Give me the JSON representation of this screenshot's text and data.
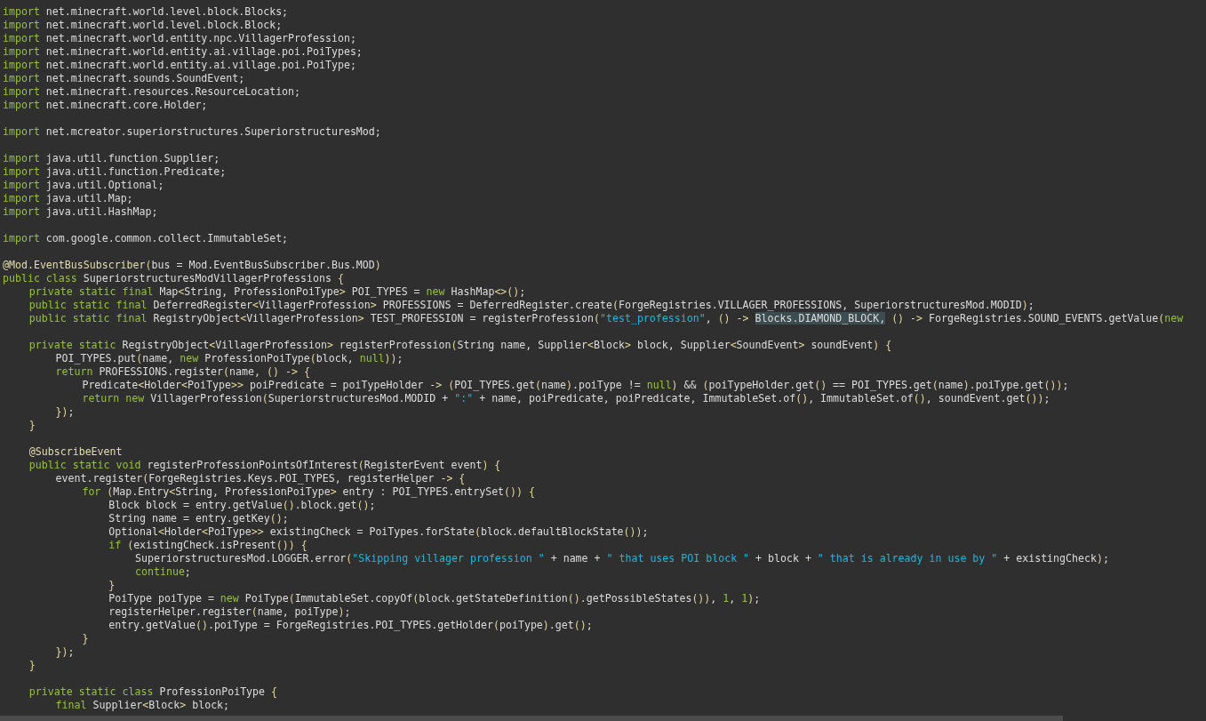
{
  "editor": {
    "lines": [
      {
        "kind": "code",
        "tokens": [
          {
            "kind": "keyword",
            "text": "import"
          },
          {
            "kind": "plain",
            "text": " net.minecraft.world.level.block.Blocks;"
          }
        ]
      },
      {
        "kind": "code",
        "tokens": [
          {
            "kind": "keyword",
            "text": "import"
          },
          {
            "kind": "plain",
            "text": " net.minecraft.world.level.block.Block;"
          }
        ]
      },
      {
        "kind": "code",
        "tokens": [
          {
            "kind": "keyword",
            "text": "import"
          },
          {
            "kind": "plain",
            "text": " net.minecraft.world.entity.npc.VillagerProfession;"
          }
        ]
      },
      {
        "kind": "code",
        "tokens": [
          {
            "kind": "keyword",
            "text": "import"
          },
          {
            "kind": "plain",
            "text": " net.minecraft.world.entity.ai.village.poi.PoiTypes;"
          }
        ]
      },
      {
        "kind": "code",
        "tokens": [
          {
            "kind": "keyword",
            "text": "import"
          },
          {
            "kind": "plain",
            "text": " net.minecraft.world.entity.ai.village.poi.PoiType;"
          }
        ]
      },
      {
        "kind": "code",
        "tokens": [
          {
            "kind": "keyword",
            "text": "import"
          },
          {
            "kind": "plain",
            "text": " net.minecraft.sounds.SoundEvent;"
          }
        ]
      },
      {
        "kind": "code",
        "tokens": [
          {
            "kind": "keyword",
            "text": "import"
          },
          {
            "kind": "plain",
            "text": " net.minecraft.resources.ResourceLocation;"
          }
        ]
      },
      {
        "kind": "code",
        "tokens": [
          {
            "kind": "keyword",
            "text": "import"
          },
          {
            "kind": "plain",
            "text": " net.minecraft.core.Holder;"
          }
        ]
      },
      {
        "kind": "blank"
      },
      {
        "kind": "code",
        "tokens": [
          {
            "kind": "keyword",
            "text": "import"
          },
          {
            "kind": "plain",
            "text": " net.mcreator.superiorstructures.SuperiorstructuresMod;"
          }
        ]
      },
      {
        "kind": "blank"
      },
      {
        "kind": "code",
        "tokens": [
          {
            "kind": "keyword",
            "text": "import"
          },
          {
            "kind": "plain",
            "text": " java.util.function.Supplier;"
          }
        ]
      },
      {
        "kind": "code",
        "tokens": [
          {
            "kind": "keyword",
            "text": "import"
          },
          {
            "kind": "plain",
            "text": " java.util.function.Predicate;"
          }
        ]
      },
      {
        "kind": "code",
        "tokens": [
          {
            "kind": "keyword",
            "text": "import"
          },
          {
            "kind": "plain",
            "text": " java.util.Optional;"
          }
        ]
      },
      {
        "kind": "code",
        "tokens": [
          {
            "kind": "keyword",
            "text": "import"
          },
          {
            "kind": "plain",
            "text": " java.util.Map;"
          }
        ]
      },
      {
        "kind": "code",
        "tokens": [
          {
            "kind": "keyword",
            "text": "import"
          },
          {
            "kind": "plain",
            "text": " java.util.HashMap;"
          }
        ]
      },
      {
        "kind": "blank"
      },
      {
        "kind": "code",
        "tokens": [
          {
            "kind": "keyword",
            "text": "import"
          },
          {
            "kind": "plain",
            "text": " com.google.common.collect.ImmutableSet;"
          }
        ]
      },
      {
        "kind": "blank"
      },
      {
        "kind": "code",
        "tokens": [
          {
            "kind": "annotation",
            "text": "@Mod.EventBusSubscriber"
          },
          {
            "kind": "plain",
            "text": "(bus = Mod.EventBusSubscriber.Bus.MOD)"
          }
        ]
      },
      {
        "kind": "code",
        "tokens": [
          {
            "kind": "keyword",
            "text": "public class"
          },
          {
            "kind": "plain",
            "text": " SuperiorstructuresModVillagerProfessions {"
          }
        ]
      },
      {
        "kind": "code",
        "tokens": [
          {
            "kind": "keyword",
            "text": "\tprivate static final"
          },
          {
            "kind": "plain",
            "text": " Map<String, ProfessionPoiType> POI_TYPES = "
          },
          {
            "kind": "keyword",
            "text": "new"
          },
          {
            "kind": "plain",
            "text": " HashMap<>();"
          }
        ]
      },
      {
        "kind": "code",
        "tokens": [
          {
            "kind": "keyword",
            "text": "\tpublic static final"
          },
          {
            "kind": "plain",
            "text": " DeferredRegister<VillagerProfession> PROFESSIONS = DeferredRegister.create(ForgeRegistries.VILLAGER_PROFESSIONS, SuperiorstructuresMod.MODID);"
          }
        ]
      },
      {
        "kind": "code",
        "tokens": [
          {
            "kind": "keyword",
            "text": "\tpublic static final"
          },
          {
            "kind": "plain",
            "text": " RegistryObject<VillagerProfession> TEST_PROFESSION = registerProfession("
          },
          {
            "kind": "string",
            "text": "\"test_profession\""
          },
          {
            "kind": "plain",
            "text": ", () -> "
          },
          {
            "kind": "selection",
            "text": "Blocks.DIAMOND_BLOCK,"
          },
          {
            "kind": "plain",
            "text": " () -> ForgeRegistries.SOUND_EVENTS.getValue("
          },
          {
            "kind": "keyword",
            "text": "new"
          }
        ]
      },
      {
        "kind": "blank"
      },
      {
        "kind": "code",
        "tokens": [
          {
            "kind": "keyword",
            "text": "\tprivate static"
          },
          {
            "kind": "plain",
            "text": " RegistryObject<VillagerProfession> registerProfession(String name, Supplier<Block> block, Supplier<SoundEvent> soundEvent) {"
          }
        ]
      },
      {
        "kind": "code",
        "tokens": [
          {
            "kind": "plain",
            "text": "\t\tPOI_TYPES.put(name, "
          },
          {
            "kind": "keyword",
            "text": "new"
          },
          {
            "kind": "plain",
            "text": " ProfessionPoiType(block, "
          },
          {
            "kind": "literal",
            "text": "null"
          },
          {
            "kind": "plain",
            "text": "));"
          }
        ]
      },
      {
        "kind": "code",
        "tokens": [
          {
            "kind": "keyword",
            "text": "\t\treturn"
          },
          {
            "kind": "plain",
            "text": " PROFESSIONS.register(name, () -> {"
          }
        ]
      },
      {
        "kind": "code",
        "tokens": [
          {
            "kind": "plain",
            "text": "\t\t\tPredicate<Holder<PoiType>> poiPredicate = poiTypeHolder -> (POI_TYPES.get(name).poiType != "
          },
          {
            "kind": "literal",
            "text": "null"
          },
          {
            "kind": "plain",
            "text": ") && (poiTypeHolder.get() == POI_TYPES.get(name).poiType.get());"
          }
        ]
      },
      {
        "kind": "code",
        "tokens": [
          {
            "kind": "keyword",
            "text": "\t\t\treturn new"
          },
          {
            "kind": "plain",
            "text": " VillagerProfession(SuperiorstructuresMod.MODID + "
          },
          {
            "kind": "string",
            "text": "\":\""
          },
          {
            "kind": "plain",
            "text": " + name, poiPredicate, poiPredicate, ImmutableSet.of(), ImmutableSet.of(), soundEvent.get());"
          }
        ]
      },
      {
        "kind": "code",
        "tokens": [
          {
            "kind": "plain",
            "text": "\t\t});"
          }
        ]
      },
      {
        "kind": "code",
        "tokens": [
          {
            "kind": "plain",
            "text": "\t}"
          }
        ]
      },
      {
        "kind": "blank"
      },
      {
        "kind": "code",
        "tokens": [
          {
            "kind": "annotation",
            "text": "\t@SubscribeEvent"
          }
        ]
      },
      {
        "kind": "code",
        "tokens": [
          {
            "kind": "keyword",
            "text": "\tpublic static void"
          },
          {
            "kind": "plain",
            "text": " registerProfessionPointsOfInterest(RegisterEvent event) {"
          }
        ]
      },
      {
        "kind": "code",
        "tokens": [
          {
            "kind": "plain",
            "text": "\t\tevent.register(ForgeRegistries.Keys.POI_TYPES, registerHelper -> {"
          }
        ]
      },
      {
        "kind": "code",
        "tokens": [
          {
            "kind": "keyword",
            "text": "\t\t\tfor"
          },
          {
            "kind": "plain",
            "text": " (Map.Entry<String, ProfessionPoiType> entry : POI_TYPES.entrySet()) {"
          }
        ]
      },
      {
        "kind": "code",
        "tokens": [
          {
            "kind": "plain",
            "text": "\t\t\t\tBlock block = entry.getValue().block.get();"
          }
        ]
      },
      {
        "kind": "code",
        "tokens": [
          {
            "kind": "plain",
            "text": "\t\t\t\tString name = entry.getKey();"
          }
        ]
      },
      {
        "kind": "code",
        "tokens": [
          {
            "kind": "plain",
            "text": "\t\t\t\tOptional<Holder<PoiType>> existingCheck = PoiTypes.forState(block.defaultBlockState());"
          }
        ]
      },
      {
        "kind": "code",
        "tokens": [
          {
            "kind": "keyword",
            "text": "\t\t\t\tif"
          },
          {
            "kind": "plain",
            "text": " (existingCheck.isPresent()) {"
          }
        ]
      },
      {
        "kind": "code",
        "tokens": [
          {
            "kind": "plain",
            "text": "\t\t\t\t\tSuperiorstructuresMod.LOGGER.error("
          },
          {
            "kind": "string",
            "text": "\"Skipping villager profession \""
          },
          {
            "kind": "plain",
            "text": " + name + "
          },
          {
            "kind": "string",
            "text": "\" that uses POI block \""
          },
          {
            "kind": "plain",
            "text": " + block + "
          },
          {
            "kind": "string",
            "text": "\" that is already in use by \""
          },
          {
            "kind": "plain",
            "text": " + existingCheck);"
          }
        ]
      },
      {
        "kind": "code",
        "tokens": [
          {
            "kind": "keyword",
            "text": "\t\t\t\t\tcontinue"
          },
          {
            "kind": "plain",
            "text": ";"
          }
        ]
      },
      {
        "kind": "code",
        "tokens": [
          {
            "kind": "plain",
            "text": "\t\t\t\t}"
          }
        ]
      },
      {
        "kind": "code",
        "tokens": [
          {
            "kind": "plain",
            "text": "\t\t\t\tPoiType poiType = "
          },
          {
            "kind": "keyword",
            "text": "new"
          },
          {
            "kind": "plain",
            "text": " PoiType(ImmutableSet.copyOf(block.getStateDefinition().getPossibleStates()), "
          },
          {
            "kind": "literal",
            "text": "1"
          },
          {
            "kind": "plain",
            "text": ", "
          },
          {
            "kind": "literal",
            "text": "1"
          },
          {
            "kind": "plain",
            "text": ");"
          }
        ]
      },
      {
        "kind": "code",
        "tokens": [
          {
            "kind": "plain",
            "text": "\t\t\t\tregisterHelper.register(name, poiType);"
          }
        ]
      },
      {
        "kind": "code",
        "tokens": [
          {
            "kind": "plain",
            "text": "\t\t\t\tentry.getValue().poiType = ForgeRegistries.POI_TYPES.getHolder(poiType).get();"
          }
        ]
      },
      {
        "kind": "code",
        "tokens": [
          {
            "kind": "plain",
            "text": "\t\t\t}"
          }
        ]
      },
      {
        "kind": "code",
        "tokens": [
          {
            "kind": "plain",
            "text": "\t\t});"
          }
        ]
      },
      {
        "kind": "code",
        "tokens": [
          {
            "kind": "plain",
            "text": "\t}"
          }
        ]
      },
      {
        "kind": "blank"
      },
      {
        "kind": "code",
        "tokens": [
          {
            "kind": "keyword",
            "text": "\tprivate static class"
          },
          {
            "kind": "plain",
            "text": " ProfessionPoiType {"
          }
        ]
      },
      {
        "kind": "code",
        "tokens": [
          {
            "kind": "keyword",
            "text": "\t\tfinal"
          },
          {
            "kind": "plain",
            "text": " Supplier<Block> block;"
          }
        ]
      }
    ]
  }
}
